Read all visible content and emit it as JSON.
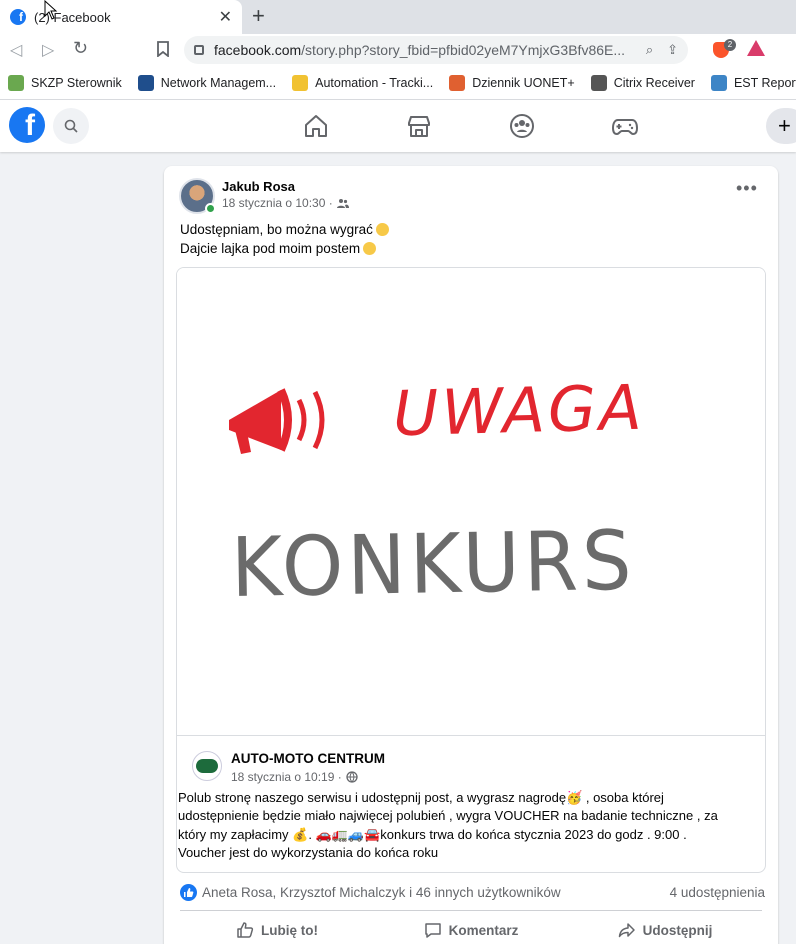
{
  "browser": {
    "tab_title": "(2) Facebook",
    "url_host": "facebook.com",
    "url_path": "/story.php?story_fbid=pfbid02yeM7YmjxG3Bfv86E...",
    "ext_badge": "2",
    "bookmarks": [
      {
        "label": "SKZP Sterownik",
        "color": "#6aa84f"
      },
      {
        "label": "Network Managem...",
        "color": "#1f4e8c"
      },
      {
        "label": "Automation - Tracki...",
        "color": "#f1c232"
      },
      {
        "label": "Dziennik UONET+",
        "color": "#e06030"
      },
      {
        "label": "Citrix Receiver",
        "color": "#555555"
      },
      {
        "label": "EST Report Men",
        "color": "#3d85c6"
      }
    ]
  },
  "facebook": {
    "logo": "f",
    "nav_icons": [
      "home-icon",
      "marketplace-icon",
      "groups-icon",
      "gaming-icon"
    ],
    "create_label": "+"
  },
  "post": {
    "author": "Jakub Rosa",
    "time": "18 stycznia o 10:30 ·",
    "line1": "Udostępniam, bo można wygrać",
    "line2": "Dajcie lajka pod moim postem",
    "image": {
      "headline": "UWAGA",
      "subheadline": "KONKURS"
    },
    "shared": {
      "page_name": "AUTO-MOTO CENTRUM",
      "time": "18 stycznia o 10:19 ·",
      "desc_lines": [
        "Polub stronę naszego  serwisu  i udostępnij post, a wygrasz nagrodę🥳 , osoba której",
        "udostępnienie będzie miało najwięcej polubień , wygra VOUCHER na badanie techniczne , za",
        "który my zapłacimy 💰. 🚗🚛🚙🚘konkurs trwa do końca stycznia 2023 do godz . 9:00 .",
        "Voucher jest do wykorzystania do końca roku"
      ]
    },
    "reactions": "Aneta Rosa, Krzysztof Michalczyk i 46 innych użytkowników",
    "shares": "4 udostępnienia",
    "actions": {
      "like": "Lubię to!",
      "comment": "Komentarz",
      "share": "Udostępnij"
    }
  },
  "colors": {
    "fb_blue": "#1877f2",
    "headline_red": "#e2262f",
    "subheadline_gray": "#6b6b6b"
  }
}
